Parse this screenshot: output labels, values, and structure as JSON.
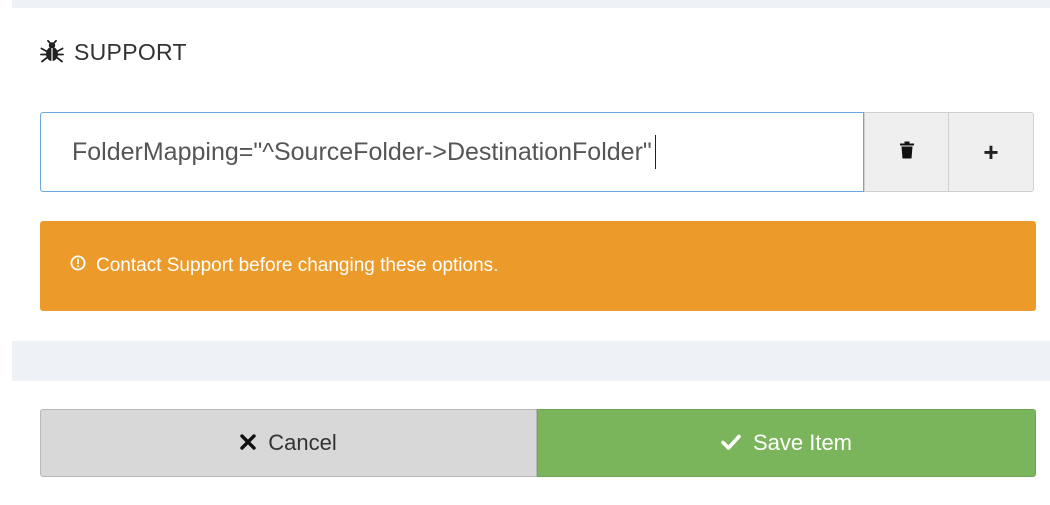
{
  "section": {
    "icon": "bug-icon",
    "title": "SUPPORT"
  },
  "option_input": {
    "value": "FolderMapping=\"^SourceFolder->DestinationFolder\""
  },
  "option_actions": {
    "delete_icon": "trash-icon",
    "add_label": "+"
  },
  "alert": {
    "icon": "exclamation-circle-icon",
    "message": "Contact Support before changing these options.",
    "color": "#ec9b2b"
  },
  "footer": {
    "cancel_icon": "close-icon",
    "cancel_label": "Cancel",
    "save_icon": "check-icon",
    "save_label": "Save Item",
    "save_color": "#7ab55c",
    "cancel_color": "#d8d8d8"
  }
}
